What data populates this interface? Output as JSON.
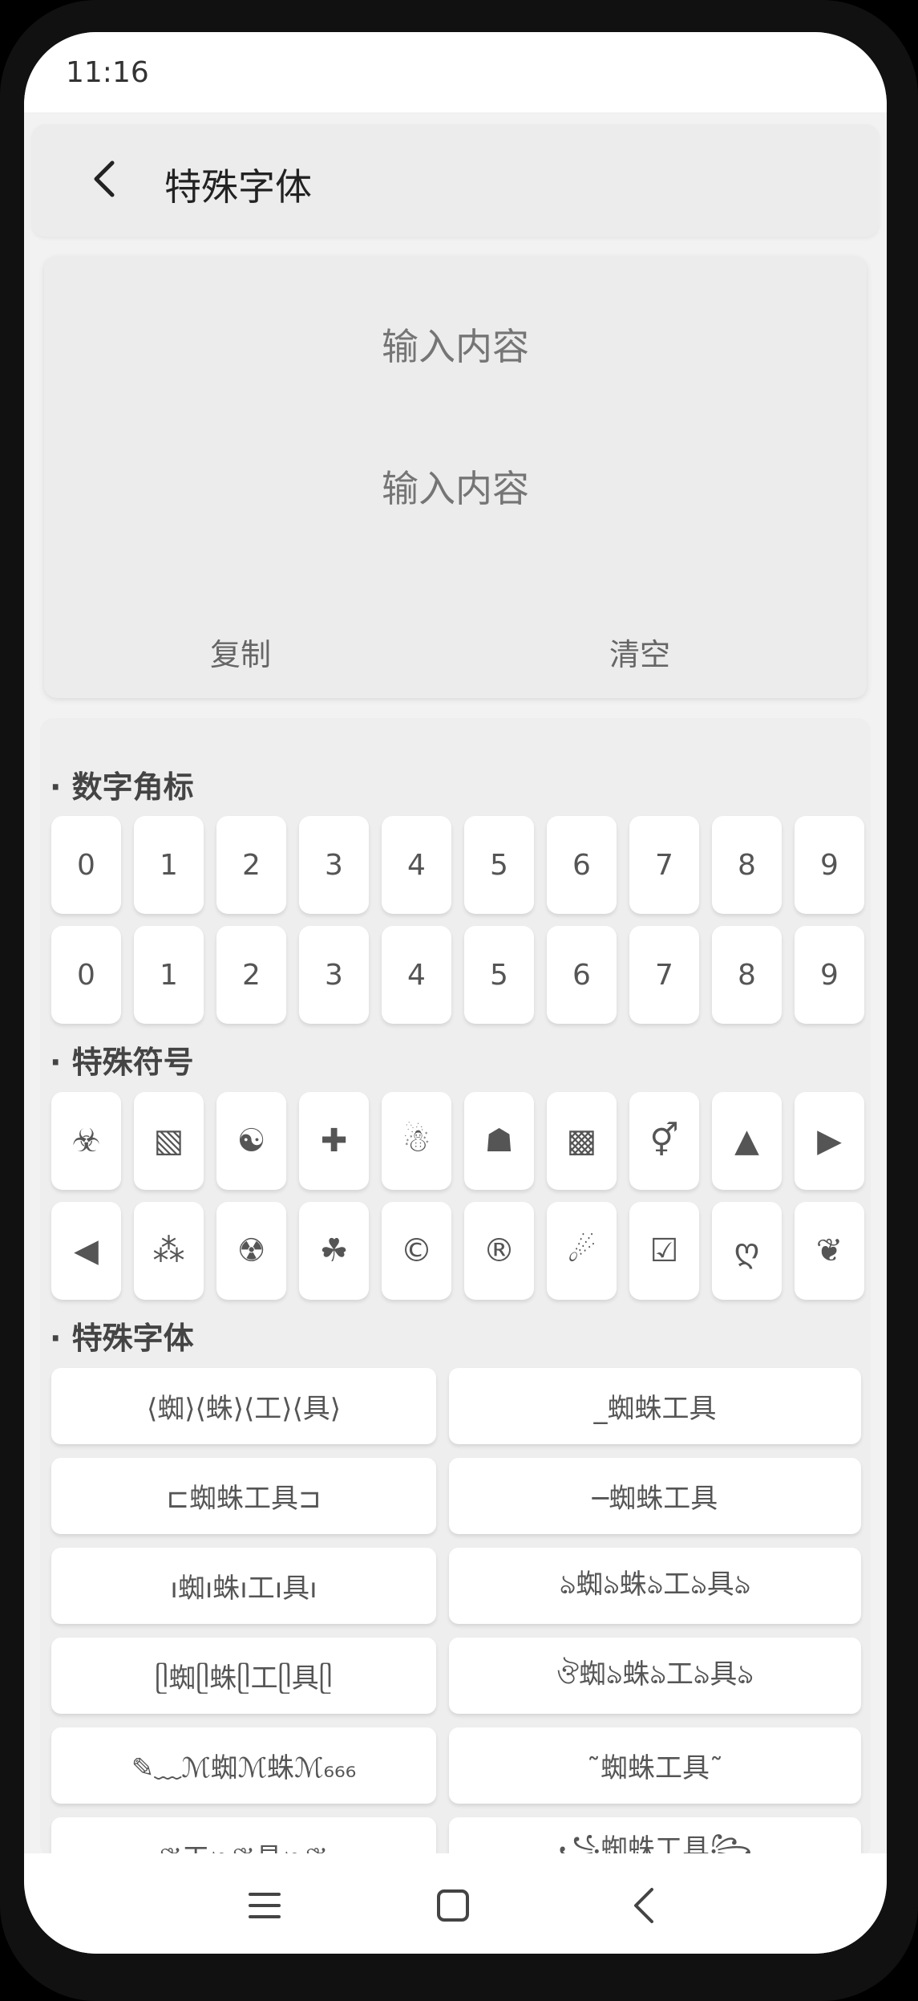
{
  "status_bar": {
    "time": "11:16"
  },
  "header": {
    "title": "特殊字体",
    "back_icon": "chevron-left-icon"
  },
  "input_card": {
    "input_placeholder": "输入内容",
    "output_placeholder": "输入内容",
    "copy_label": "复制",
    "clear_label": "清空"
  },
  "sections": {
    "numbers_title": "· 数字角标",
    "symbols_title": "· 特殊符号",
    "fonts_title": "· 特殊字体"
  },
  "number_rows": [
    [
      "0",
      "1",
      "2",
      "3",
      "4",
      "5",
      "6",
      "7",
      "8",
      "9"
    ],
    [
      "0",
      "1",
      "2",
      "3",
      "4",
      "5",
      "6",
      "7",
      "8",
      "9"
    ]
  ],
  "symbol_rows": [
    [
      "☣",
      "▧",
      "☯",
      "✚",
      "☃",
      "☗",
      "▩",
      "⚥",
      "▲",
      "▶"
    ],
    [
      "◀",
      "⁂",
      "☢",
      "☘",
      "©",
      "®",
      "☄",
      "☑",
      "ღ",
      "❦"
    ]
  ],
  "font_styles": [
    "⟨蜘⟩⟨蛛⟩⟨工⟩⟨具⟩",
    "_蜘蛛工具",
    "⊏蜘蛛工具⊐",
    "─蜘蛛工具",
    "ı蜘ı蛛ı工ı具ı",
    "ঌ蜘ঌ蛛ঌ工ঌ具ঌ",
    "ᥫ蜘ᥫ蛛ᥫ工ᥫ具ᥫ",
    "ঔ蜘ঌ蛛ঌ工ঌ具ঌ",
    "✎﹏ℳ蜘ℳ蛛ℳ₆₆₆",
    "˜蜘蛛工具˜",
    "❦工❧❦具❧❦",
    "꧁蜘蛛工具꧂"
  ],
  "nav_bar": {
    "menu_icon": "menu-icon",
    "home_icon": "home-square-icon",
    "back_icon": "back-chevron-icon"
  }
}
